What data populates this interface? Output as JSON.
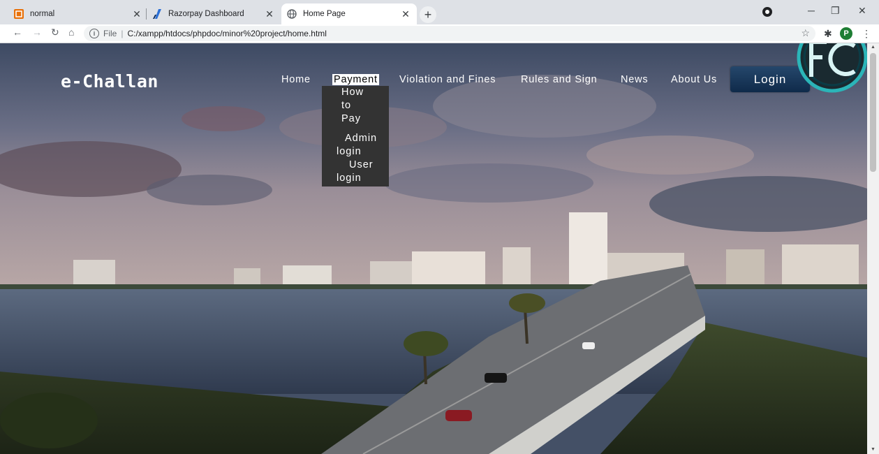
{
  "browser": {
    "tabs": [
      {
        "title": "normal",
        "icon": "grid-favicon-icon"
      },
      {
        "title": "Razorpay Dashboard",
        "icon": "razorpay-favicon-icon"
      },
      {
        "title": "Home Page",
        "icon": "globe-favicon-icon",
        "active": true
      }
    ],
    "url_scheme": "File",
    "url_path": "C:/xampp/htdocs/phpdoc/minor%20project/home.html",
    "profile_initial": "P"
  },
  "site": {
    "brand": "e-Challan",
    "nav": {
      "home": "Home",
      "payment": "Payment",
      "violation": "Violation and Fines",
      "rules": "Rules and Sign",
      "news": "News",
      "about": "About Us"
    },
    "login_label": "Login",
    "payment_menu": {
      "how_to_pay": [
        "How",
        "to",
        "Pay"
      ],
      "admin_login": [
        "Admin",
        "login"
      ],
      "user_login": [
        "User",
        "login"
      ]
    }
  },
  "colors": {
    "tabstrip": "#dee1e6",
    "login_button": "#1b3a5c",
    "dropdown_bg": "#333333",
    "logo_ring": "#28c8c8"
  }
}
